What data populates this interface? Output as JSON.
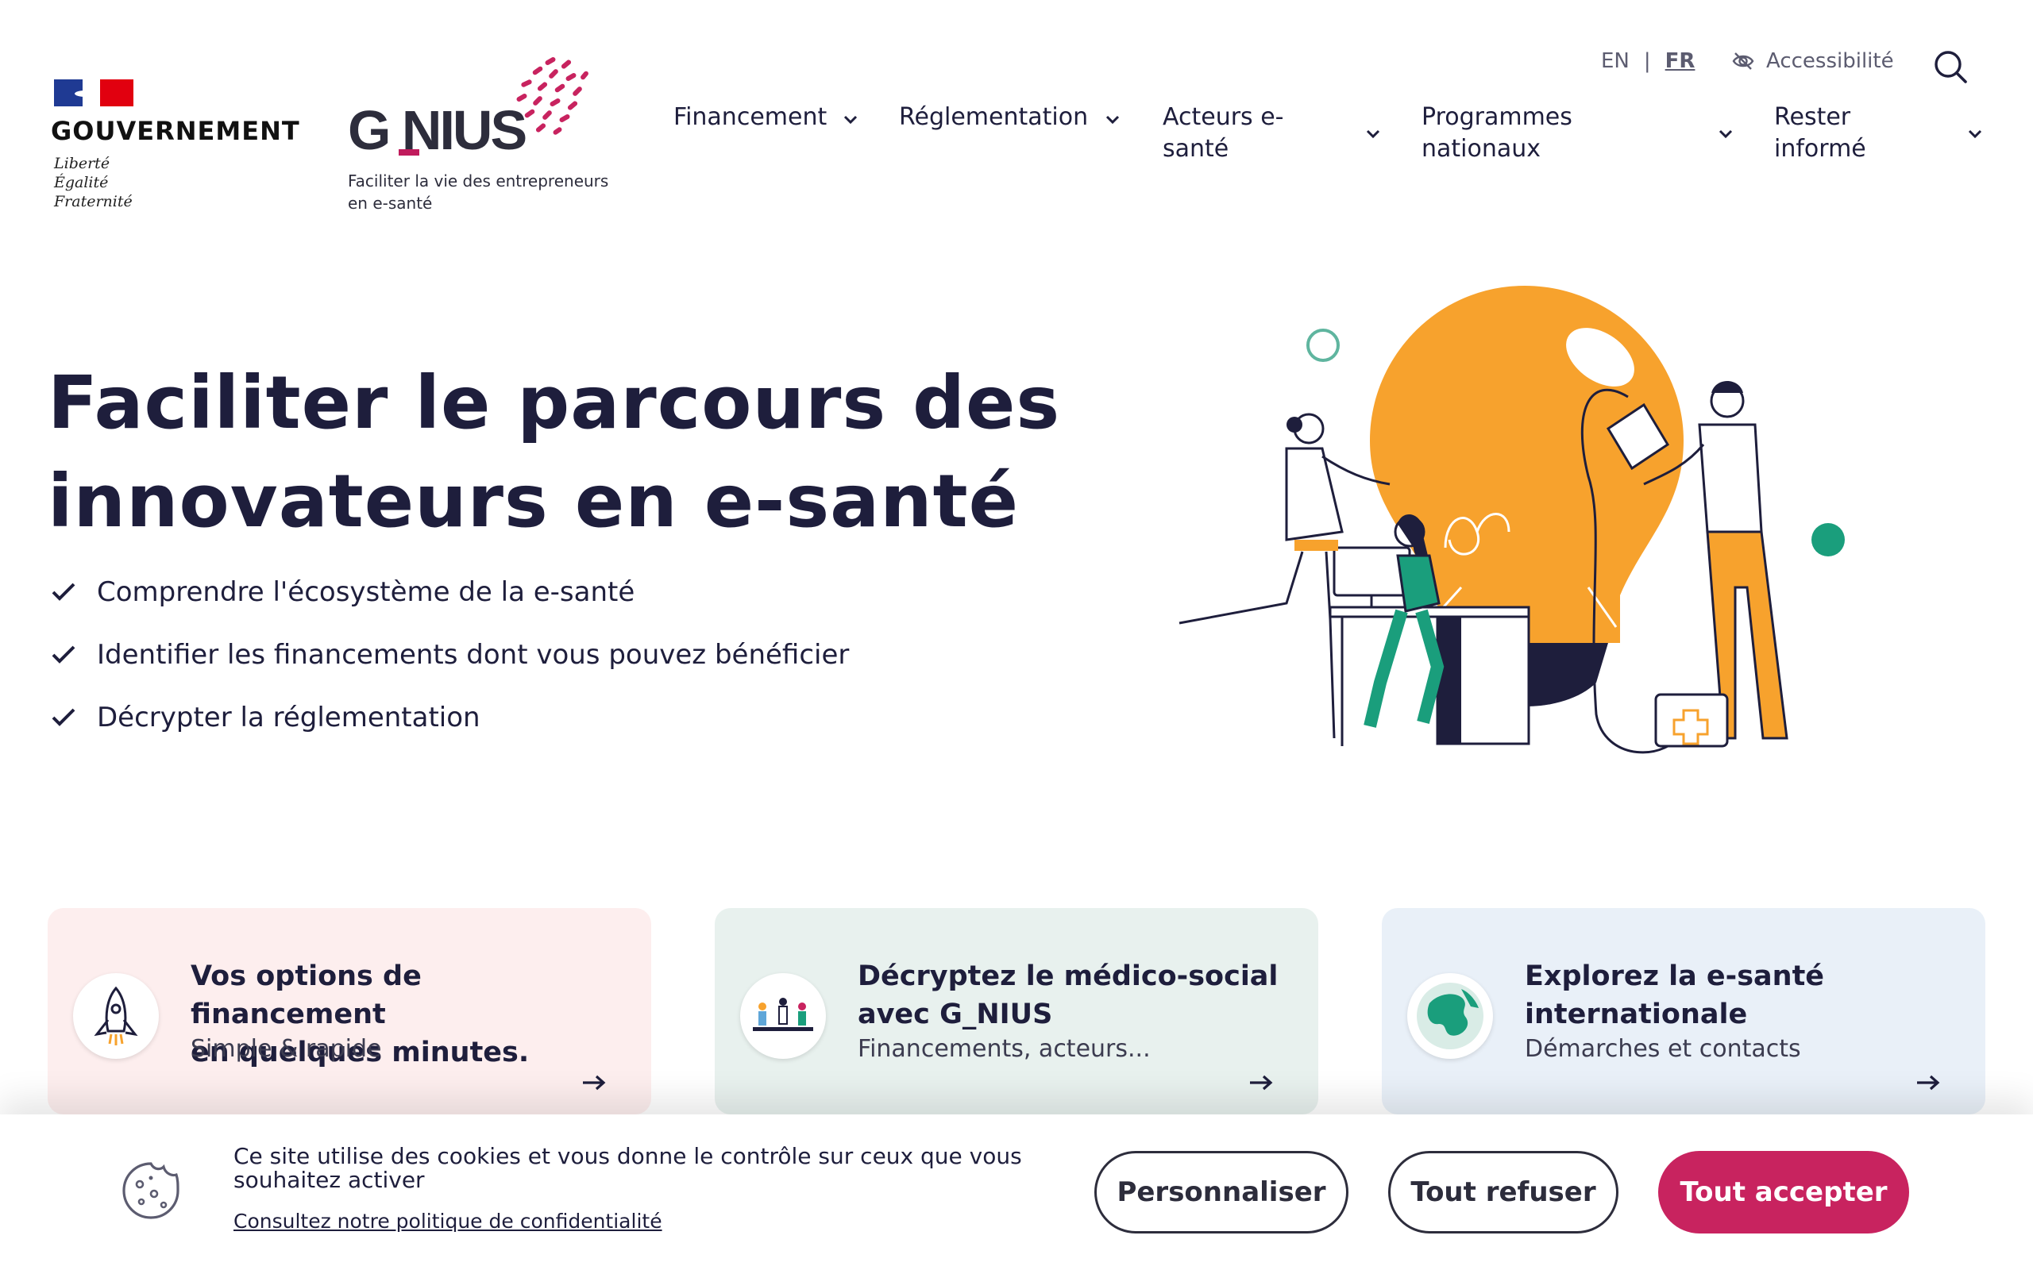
{
  "gov": {
    "name": "GOUVERNEMENT",
    "motto_line1": "Liberté",
    "motto_line2": "Égalité",
    "motto_line3": "Fraternité"
  },
  "brand": {
    "name": "G_NIUS",
    "wordmark": "G NIUS",
    "tagline_line1": "Faciliter la vie des entrepreneurs",
    "tagline_line2": "en e-santé",
    "accent_color": "#c8235f"
  },
  "nav": {
    "items": [
      {
        "label_line1": "Financement",
        "label_line2": ""
      },
      {
        "label_line1": "Réglementation",
        "label_line2": ""
      },
      {
        "label_line1": "Acteurs e-",
        "label_line2": "santé"
      },
      {
        "label_line1": "Programmes",
        "label_line2": "nationaux"
      },
      {
        "label_line1": "Rester",
        "label_line2": "informé"
      }
    ],
    "lang_en": "EN",
    "lang_sep": "|",
    "lang_fr": "FR",
    "accessibility": "Accessibilité"
  },
  "hero": {
    "title_line1": "Faciliter le parcours des",
    "title_line2": "innovateurs en e-santé",
    "bullets": [
      "Comprendre l'écosystème de la e-santé",
      "Identifier les financements dont vous pouvez bénéficier",
      "Décrypter la réglementation"
    ]
  },
  "cards": [
    {
      "title_line1": "Vos options de financement",
      "title_line2": "en quelques minutes.",
      "subtitle": "Simple & rapide",
      "icon": "rocket-icon",
      "bg": "#fdeeee"
    },
    {
      "title_line1": "Décryptez le médico-social",
      "title_line2": "avec G_NIUS",
      "subtitle": "Financements, acteurs...",
      "icon": "people-icon",
      "bg": "#e8f1ee"
    },
    {
      "title_line1": "Explorez la e-santé",
      "title_line2": "internationale",
      "subtitle": "Démarches et contacts",
      "icon": "globe-icon",
      "bg": "#e9f0f8"
    }
  ],
  "cookie": {
    "text": "Ce site utilise des cookies et vous donne le contrôle sur ceux que vous souhaitez activer",
    "policy_link": "Consultez notre politique de confidentialité",
    "btn_customize": "Personnaliser",
    "btn_refuse": "Tout refuser",
    "btn_accept": "Tout accepter"
  }
}
